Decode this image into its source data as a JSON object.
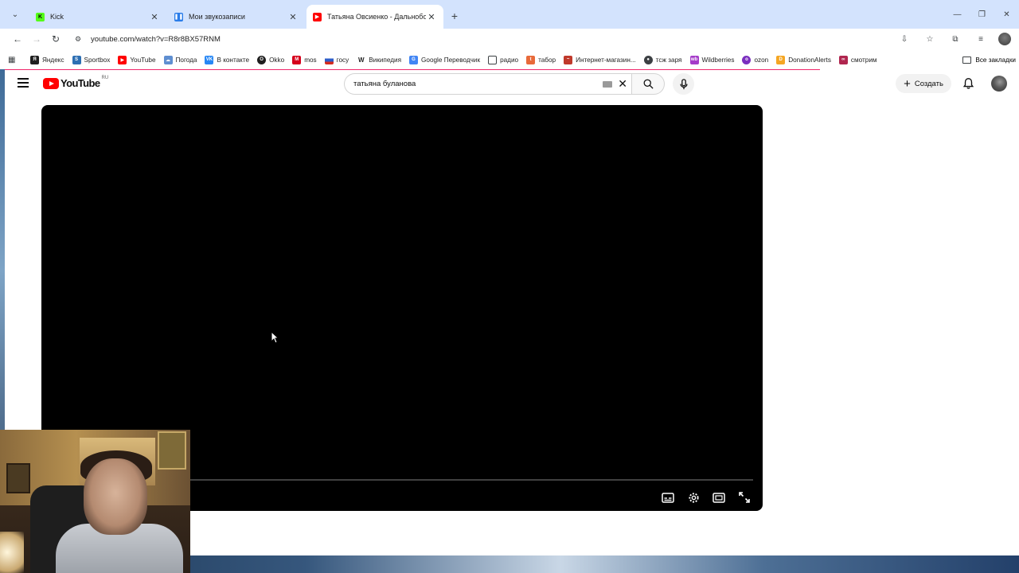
{
  "tabs": [
    {
      "title": "Kick",
      "favicon_color": "#53fc18",
      "favicon_letter": "K",
      "active": false
    },
    {
      "title": "Мои звукозаписи",
      "favicon_color": "#2b7de9",
      "favicon_letter": "",
      "active": false
    },
    {
      "title": "Татьяна Овсиенко - Дальнобой",
      "favicon_color": "#ff0000",
      "favicon_letter": "",
      "active": true
    }
  ],
  "address": {
    "url": "youtube.com/watch?v=R8r8BX57RNM"
  },
  "bookmarks": [
    {
      "label": "Яндекс",
      "color": "#1f1f1f"
    },
    {
      "label": "Sportbox",
      "color": "#2d6fb3"
    },
    {
      "label": "YouTube",
      "color": "#ff0000"
    },
    {
      "label": "Погода",
      "color": "#5f8fd1"
    },
    {
      "label": "В контакте",
      "color": "#2787f5"
    },
    {
      "label": "Okko",
      "color": "#1f1f1f"
    },
    {
      "label": "mos",
      "color": "#d6001c"
    },
    {
      "label": "госу",
      "color": "#c43b3b"
    },
    {
      "label": "Википедия",
      "color": "#555555"
    },
    {
      "label": "Google Переводчик",
      "color": "#4285f4"
    },
    {
      "label": "радио",
      "color": "#5f6368"
    },
    {
      "label": "табор",
      "color": "#e86a3a"
    },
    {
      "label": "Интернет-магазин...",
      "color": "#c0392b"
    },
    {
      "label": "тсж заря",
      "color": "#3c4043"
    },
    {
      "label": "Wildberries",
      "color": "#a53cc9"
    },
    {
      "label": "ozon",
      "color": "#7b2fbf"
    },
    {
      "label": "DonationAlerts",
      "color": "#f5a623"
    },
    {
      "label": "смотрим",
      "color": "#b0264f"
    }
  ],
  "bookmarks_all": "Все закладки",
  "youtube": {
    "logo_text": "YouTube",
    "region": "RU",
    "search_value": "татьяна буланова",
    "create_label": "Создать"
  },
  "player": {
    "state": "loading"
  },
  "colors": {
    "tabstrip": "#d3e3fd",
    "progress": "#f0266b",
    "yt_red": "#ff0000"
  }
}
